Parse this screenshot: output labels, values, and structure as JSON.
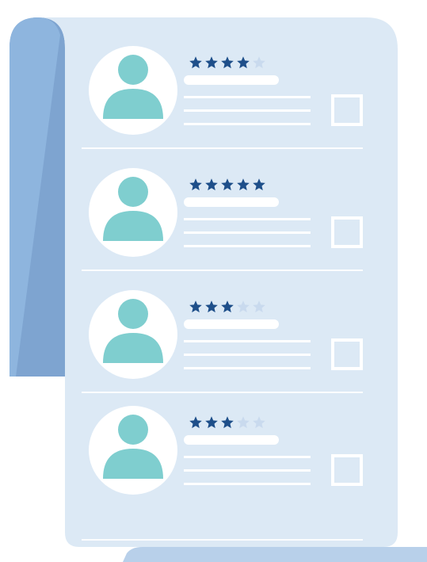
{
  "palette": {
    "sheet": "#dce9f5",
    "roll_front": "#8eb5de",
    "roll_back": "#7ea4d0",
    "avatar_fill": "#7fcecf",
    "star_filled": "#1e4f8a",
    "star_empty": "#c9daee",
    "white": "#ffffff"
  },
  "reviews": [
    {
      "rating": 4,
      "max_rating": 5
    },
    {
      "rating": 5,
      "max_rating": 5
    },
    {
      "rating": 3,
      "max_rating": 5
    },
    {
      "rating": 3,
      "max_rating": 5
    }
  ],
  "icons": {
    "avatar": "user-silhouette-icon",
    "star": "star-icon",
    "checkbox": "checkbox-empty"
  }
}
